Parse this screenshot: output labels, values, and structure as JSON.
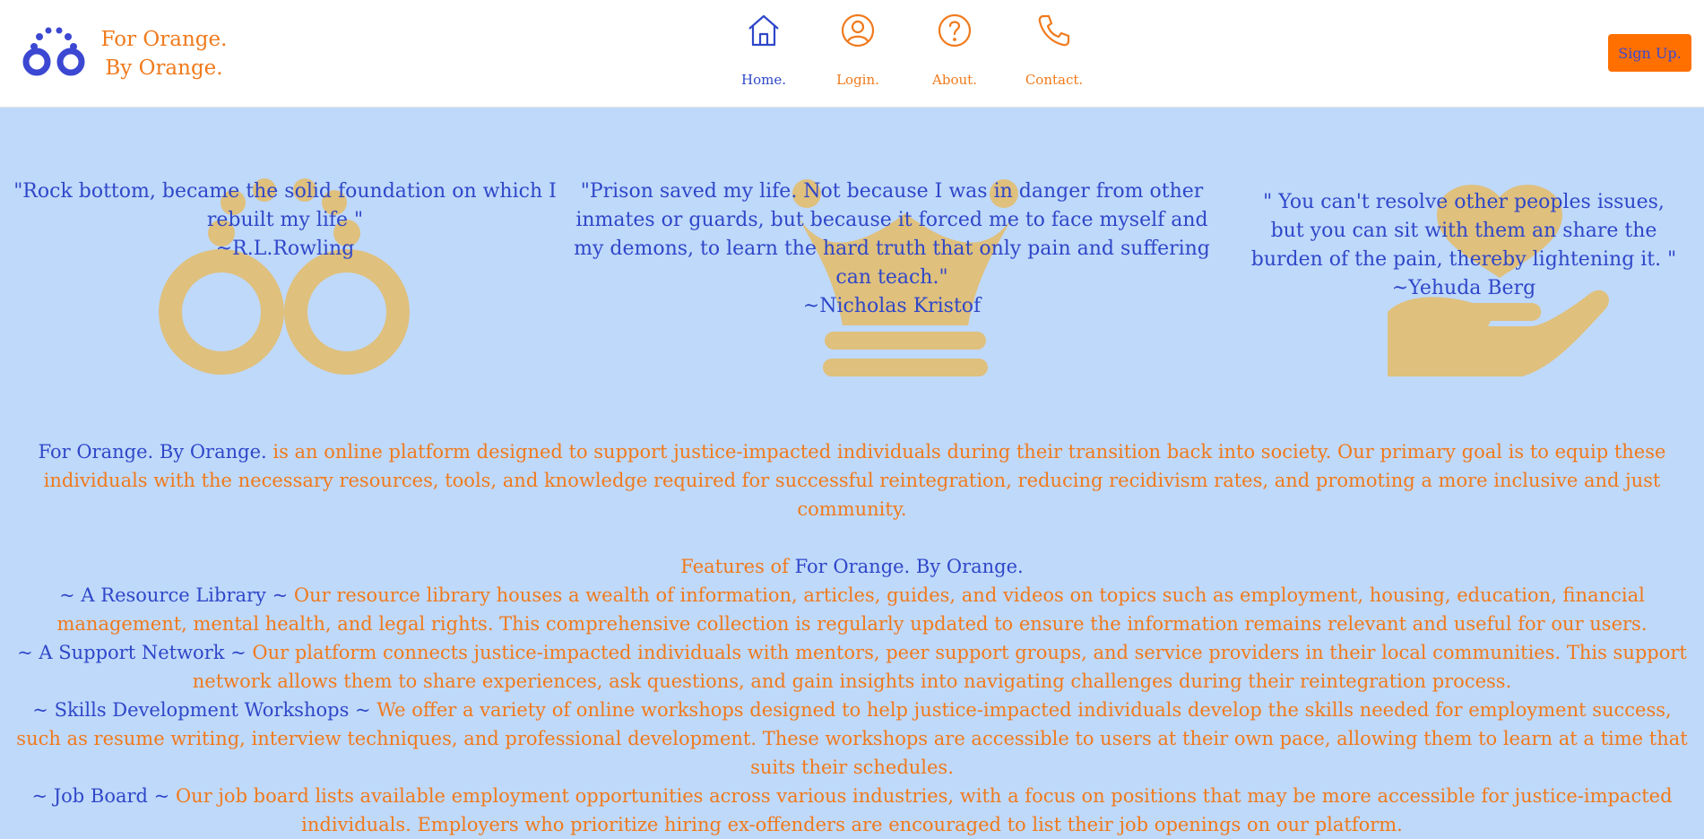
{
  "header": {
    "brand_line1": "For Orange.",
    "brand_line2": "By Orange.",
    "nav": [
      {
        "label": "Home.",
        "icon": "home-icon",
        "color": "#2f47c8"
      },
      {
        "label": "Login.",
        "icon": "user-circle-icon",
        "color": "#f07a1c"
      },
      {
        "label": "About.",
        "icon": "help-circle-icon",
        "color": "#f07a1c"
      },
      {
        "label": "Contact.",
        "icon": "phone-icon",
        "color": "#f07a1c"
      }
    ],
    "signup_label": "Sign Up."
  },
  "quotes": [
    {
      "text": "\"Rock bottom, became the solid foundation on which I rebuilt my life \"",
      "author": "~R.L.Rowling",
      "art": "handcuffs-icon"
    },
    {
      "text": "\"Prison saved my life. Not because I was in danger from other inmates or guards, but because it forced me to face myself and my demons, to learn the hard truth that only pain and suffering can teach.\"",
      "author": "~Nicholas Kristof",
      "art": "chess-queen-icon"
    },
    {
      "text": "\" You can't resolve other peoples issues, but you can sit with them an share the burden of the pain, thereby lightening it. \"",
      "author": "~Yehuda Berg",
      "art": "hand-heart-icon"
    }
  ],
  "intro": {
    "brand": "For Orange. By Orange.",
    "text": " is an online platform designed to support justice-impacted individuals during their transition back into society. Our primary goal is to equip these individuals with the necessary resources, tools, and knowledge required for successful reintegration, reducing recidivism rates, and promoting a more inclusive and just community."
  },
  "features": {
    "heading_prefix": "Features of ",
    "heading_brand": "For Orange. By Orange.",
    "items": [
      {
        "title": "~ A Resource Library ~ ",
        "text": "Our resource library houses a wealth of information, articles, guides, and videos on topics such as employment, housing, education, financial management, mental health, and legal rights. This comprehensive collection is regularly updated to ensure the information remains relevant and useful for our users."
      },
      {
        "title": "~ A Support Network ~ ",
        "text": "Our platform connects justice-impacted individuals with mentors, peer support groups, and service providers in their local communities. This support network allows them to share experiences, ask questions, and gain insights into navigating challenges during their reintegration process."
      },
      {
        "title": "~ Skills Development Workshops ~ ",
        "text": "We offer a variety of online workshops designed to help justice-impacted individuals develop the skills needed for employment success, such as resume writing, interview techniques, and professional development. These workshops are accessible to users at their own pace, allowing them to learn at a time that suits their schedules."
      },
      {
        "title": "~ Job Board ~ ",
        "text": "Our job board lists available employment opportunities across various industries, with a focus on positions that may be more accessible for justice-impacted individuals. Employers who prioritize hiring ex-offenders are encouraged to list their job openings on our platform."
      }
    ]
  },
  "colors": {
    "accent": "#f07a1c",
    "primary": "#2f47c8",
    "background": "#bfd9fb",
    "art": "#dfc07d",
    "button": "#ff7000"
  }
}
